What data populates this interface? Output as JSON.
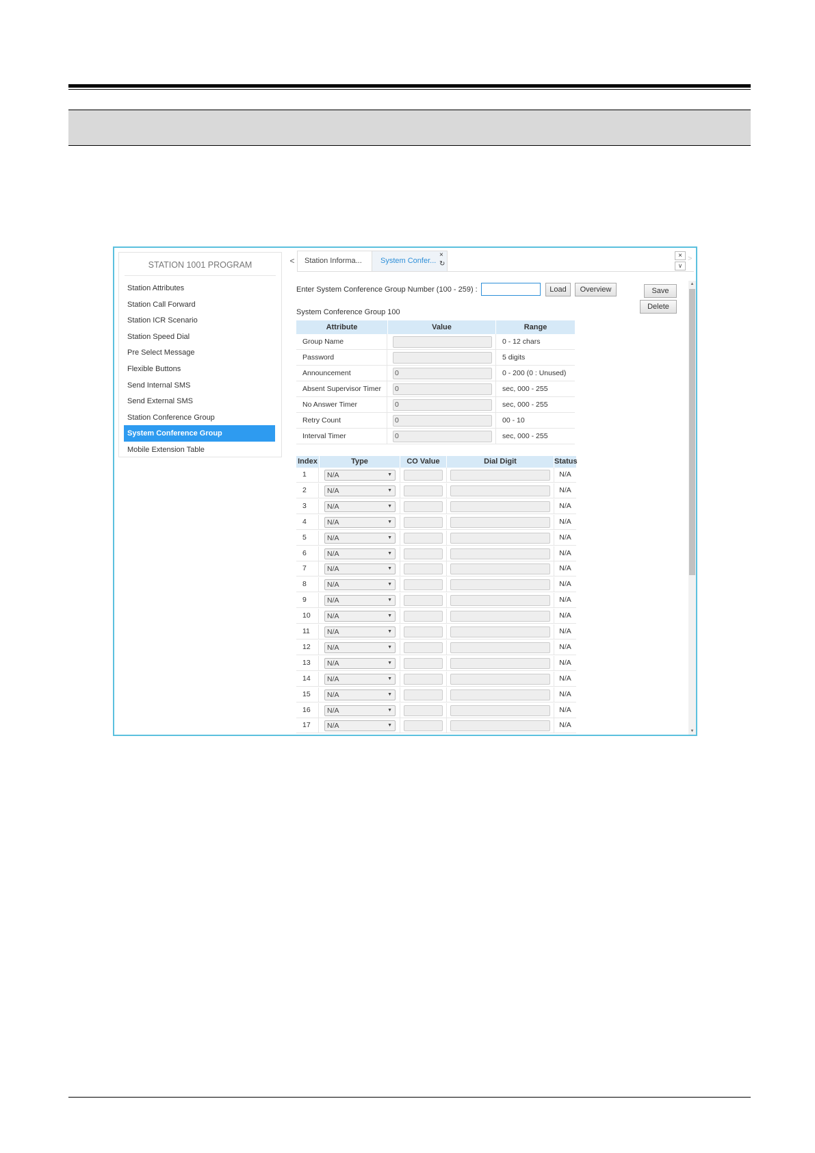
{
  "sidebar": {
    "title": "STATION 1001 PROGRAM",
    "items": [
      {
        "label": "Station Attributes",
        "active": false
      },
      {
        "label": "Station Call Forward",
        "active": false
      },
      {
        "label": "Station ICR Scenario",
        "active": false
      },
      {
        "label": "Station Speed Dial",
        "active": false
      },
      {
        "label": "Pre Select Message",
        "active": false
      },
      {
        "label": "Flexible Buttons",
        "active": false
      },
      {
        "label": "Send Internal SMS",
        "active": false
      },
      {
        "label": "Send External SMS",
        "active": false
      },
      {
        "label": "Station Conference Group",
        "active": false
      },
      {
        "label": "System Conference Group",
        "active": true
      },
      {
        "label": "Mobile Extension Table",
        "active": false
      }
    ]
  },
  "tabs": [
    {
      "label": "Station Informa...",
      "active": false
    },
    {
      "label": "System Confer...",
      "active": true
    }
  ],
  "tab_controls": {
    "prev": "<",
    "next": ">",
    "close": "×",
    "refresh": "↻",
    "window_close": "×",
    "window_menu": "∨"
  },
  "form": {
    "enter_label": "Enter System Conference Group Number (100 - 259) :",
    "group_number_value": "",
    "load_label": "Load",
    "overview_label": "Overview",
    "save_label": "Save",
    "delete_label": "Delete",
    "group_caption": "System Conference Group 100"
  },
  "attributes": {
    "headers": {
      "attribute": "Attribute",
      "value": "Value",
      "range": "Range"
    },
    "rows": [
      {
        "name": "Group Name",
        "value": "",
        "range": "0 - 12 chars"
      },
      {
        "name": "Password",
        "value": "",
        "range": "5 digits"
      },
      {
        "name": "Announcement",
        "value": "0",
        "range": "0 - 200 (0 : Unused)"
      },
      {
        "name": "Absent Supervisor Timer",
        "value": "0",
        "range": "sec, 000 - 255"
      },
      {
        "name": "No Answer Timer",
        "value": "0",
        "range": "sec, 000 - 255"
      },
      {
        "name": "Retry Count",
        "value": "0",
        "range": "00 - 10"
      },
      {
        "name": "Interval Timer",
        "value": "0",
        "range": "sec, 000 - 255"
      }
    ]
  },
  "index_table": {
    "headers": {
      "index": "Index",
      "type": "Type",
      "co_value": "CO Value",
      "dial_digit": "Dial Digit",
      "status": "Status"
    },
    "rows": [
      {
        "index": "1",
        "type": "N/A",
        "status": "N/A"
      },
      {
        "index": "2",
        "type": "N/A",
        "status": "N/A"
      },
      {
        "index": "3",
        "type": "N/A",
        "status": "N/A"
      },
      {
        "index": "4",
        "type": "N/A",
        "status": "N/A"
      },
      {
        "index": "5",
        "type": "N/A",
        "status": "N/A"
      },
      {
        "index": "6",
        "type": "N/A",
        "status": "N/A"
      },
      {
        "index": "7",
        "type": "N/A",
        "status": "N/A"
      },
      {
        "index": "8",
        "type": "N/A",
        "status": "N/A"
      },
      {
        "index": "9",
        "type": "N/A",
        "status": "N/A"
      },
      {
        "index": "10",
        "type": "N/A",
        "status": "N/A"
      },
      {
        "index": "11",
        "type": "N/A",
        "status": "N/A"
      },
      {
        "index": "12",
        "type": "N/A",
        "status": "N/A"
      },
      {
        "index": "13",
        "type": "N/A",
        "status": "N/A"
      },
      {
        "index": "14",
        "type": "N/A",
        "status": "N/A"
      },
      {
        "index": "15",
        "type": "N/A",
        "status": "N/A"
      },
      {
        "index": "16",
        "type": "N/A",
        "status": "N/A"
      },
      {
        "index": "17",
        "type": "N/A",
        "status": "N/A"
      }
    ]
  },
  "colors": {
    "accent": "#2e9bf0",
    "frame_border": "#5bc0de",
    "header_fill": "#d6e9f7"
  }
}
